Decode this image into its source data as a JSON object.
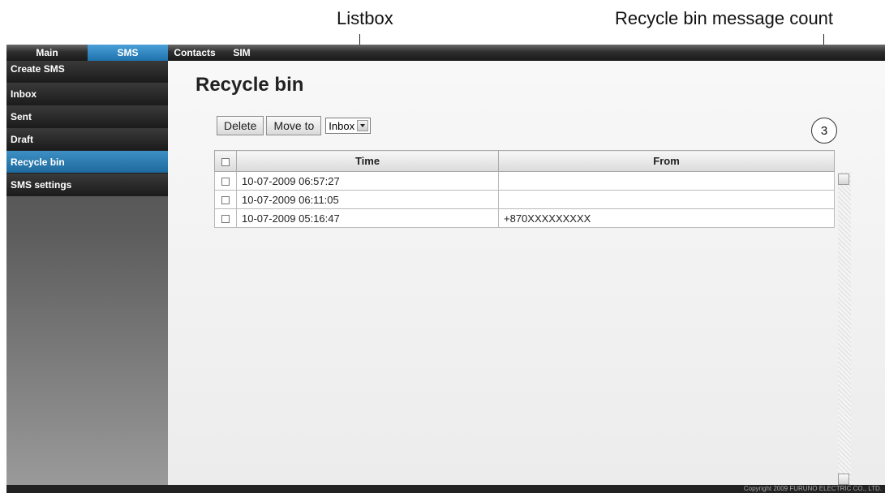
{
  "annotations": {
    "listbox": "Listbox",
    "count": "Recycle bin message count"
  },
  "nav": {
    "tabs": [
      {
        "label": "Main",
        "active": false
      },
      {
        "label": "SMS",
        "active": true
      },
      {
        "label": "Contacts",
        "active": false
      },
      {
        "label": "SIM",
        "active": false
      }
    ]
  },
  "sidebar": {
    "items": [
      {
        "label": "Create SMS",
        "active": false
      },
      {
        "label": "Inbox",
        "active": false
      },
      {
        "label": "Sent",
        "active": false
      },
      {
        "label": "Draft",
        "active": false
      },
      {
        "label": "Recycle bin",
        "active": true
      },
      {
        "label": "SMS settings",
        "active": false
      }
    ]
  },
  "main": {
    "title": "Recycle bin",
    "toolbar": {
      "delete_label": "Delete",
      "move_label": "Move to",
      "listbox_value": "Inbox"
    },
    "message_count": "3",
    "table": {
      "columns": [
        "Time",
        "From"
      ],
      "rows": [
        {
          "time": "10-07-2009 06:57:27",
          "from": ""
        },
        {
          "time": "10-07-2009 06:11:05",
          "from": ""
        },
        {
          "time": "10-07-2009 05:16:47",
          "from": "+870XXXXXXXXX"
        }
      ]
    }
  },
  "footer": {
    "copyright": "Copyright 2009 FURUNO ELECTRIC CO., LTD."
  },
  "colors": {
    "accent": "#2f86bf",
    "nav_dark": "#1f1f1f"
  },
  "icons": {
    "listbox_arrow": "chevron-down-icon",
    "scroll_up": "scroll-up-icon",
    "scroll_down": "scroll-down-icon"
  }
}
